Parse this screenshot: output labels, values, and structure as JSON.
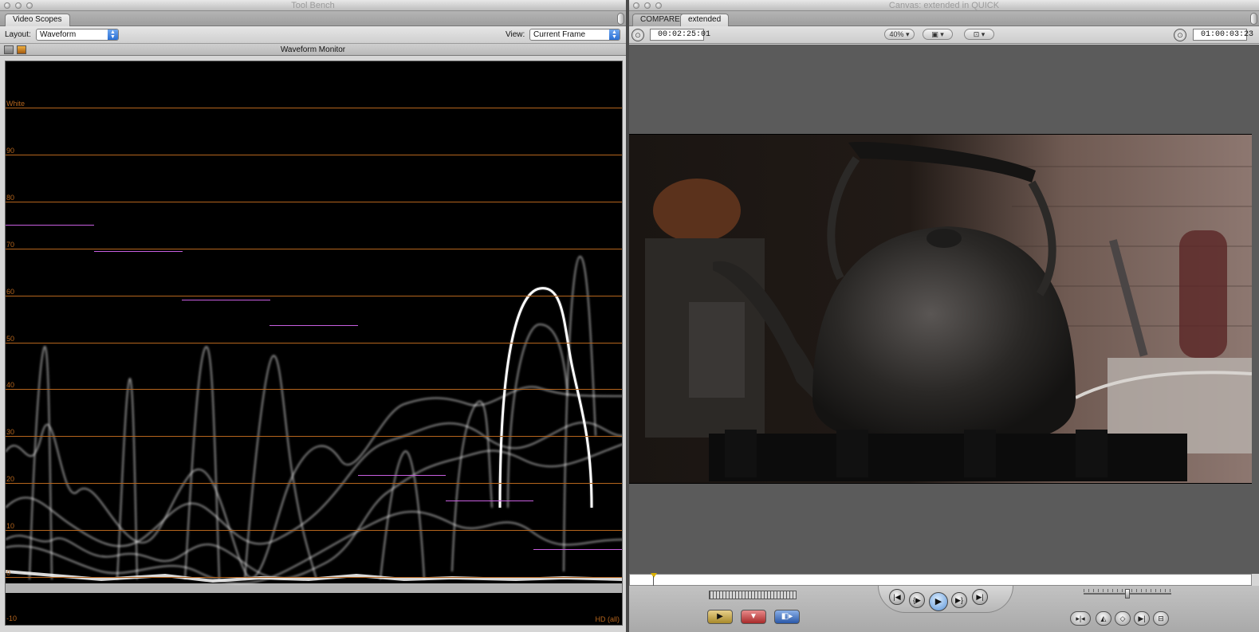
{
  "toolbench": {
    "title": "Tool Bench",
    "tab_label": "Video Scopes",
    "layout_label": "Layout:",
    "layout_value": "Waveform",
    "view_label": "View:",
    "view_value": "Current Frame",
    "scope_title": "Waveform Monitor",
    "graticule": [
      "White",
      "90",
      "80",
      "70",
      "60",
      "50",
      "40",
      "30",
      "20",
      "10",
      "0",
      "-10"
    ],
    "footer_label": "HD (all)"
  },
  "canvas": {
    "title": "Canvas: extended in QUICK",
    "tabs": [
      {
        "label": "COMPARE"
      },
      {
        "label": "extended"
      }
    ],
    "current_timecode": "00:02:25:01",
    "zoom_label": "40%",
    "duration_timecode": "01:00:03:23"
  },
  "colors": {
    "graticule": "#b5651d",
    "magenta_marker": "#c85fe0",
    "play_blue": "#5b93d6",
    "playhead_yellow": "#d9b000"
  },
  "icons": {
    "transport": [
      "go-to-in-icon",
      "play-in-to-out-icon",
      "play-icon",
      "play-around-icon",
      "go-to-out-icon"
    ],
    "edit": [
      "insert-icon",
      "overwrite-icon",
      "replace-icon"
    ],
    "marks": [
      "mark-clip-icon",
      "mark-in-icon",
      "add-keyframe-icon",
      "add-marker-icon",
      "mark-out-icon"
    ]
  }
}
